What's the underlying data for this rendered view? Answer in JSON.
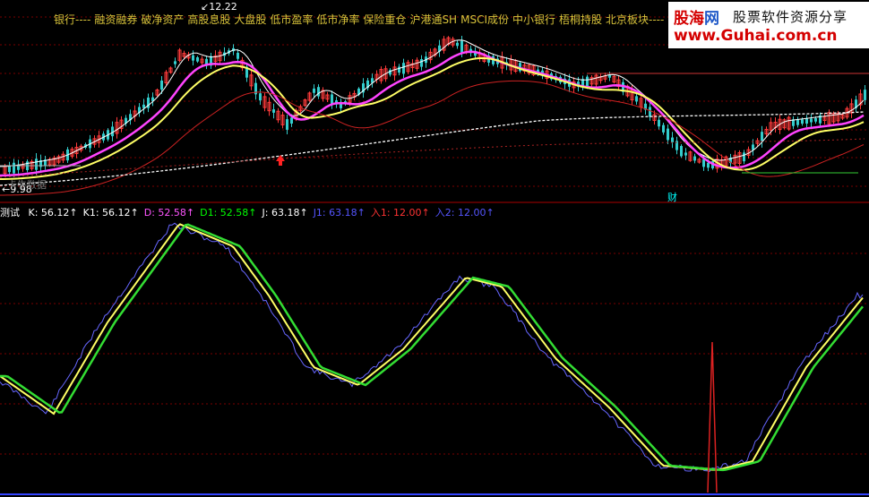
{
  "tags": [
    "银行----",
    "融资融券",
    "破净资产",
    "高股息股",
    "大盘股",
    "低市盈率",
    "低市净率",
    "保险重仓",
    "沪港通SH",
    "MSCI成份",
    "中小银行",
    "梧桐持股",
    "北京板块----"
  ],
  "watermark": {
    "brand_red": "股海",
    "brand_blue": "网",
    "subtitle": "股票软件资源分享",
    "url": "www.Guhai.com.cn"
  },
  "price": {
    "high_label": "12.22",
    "low_label": "9.98",
    "overlay_text": "卡牛数据",
    "finance_marker": "财"
  },
  "indicator": {
    "name": "测试",
    "values": [
      {
        "label": "K:",
        "value": "56.12",
        "color": "#ffffff"
      },
      {
        "label": "K1:",
        "value": "56.12",
        "color": "#ffffff"
      },
      {
        "label": "D:",
        "value": "52.58",
        "color": "#ff55ff"
      },
      {
        "label": "D1:",
        "value": "52.58",
        "color": "#00ff00"
      },
      {
        "label": "J:",
        "value": "63.18",
        "color": "#ffffff"
      },
      {
        "label": "J1:",
        "value": "63.18",
        "color": "#5555ff"
      },
      {
        "label": "入1:",
        "value": "12.00",
        "color": "#ff3333"
      },
      {
        "label": "入2:",
        "value": "12.00",
        "color": "#5555ff"
      }
    ]
  },
  "colors": {
    "background": "#000000",
    "grid": "#7a0000",
    "candle_up": "#ff3b3b",
    "candle_down": "#33cccc",
    "ma_white": "#ffffff",
    "ma_yellow": "#ffff66",
    "ma_magenta": "#ff44ff",
    "ma_red": "#cc2222",
    "k_line": "#6666ff",
    "d_line": "#ffff66",
    "j_line": "#33dd33"
  }
}
